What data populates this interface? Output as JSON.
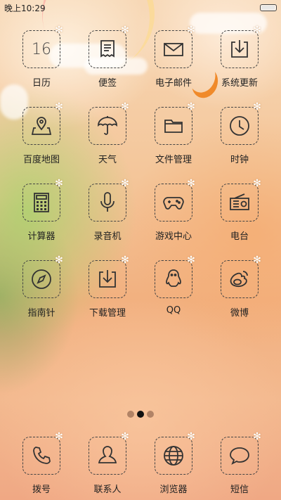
{
  "statusbar": {
    "time": "晚上10:29"
  },
  "apps": [
    {
      "label": "日历",
      "icon": "calendar-icon",
      "number": "16"
    },
    {
      "label": "便签",
      "icon": "note-icon"
    },
    {
      "label": "电子邮件",
      "icon": "mail-icon"
    },
    {
      "label": "系统更新",
      "icon": "system-update-icon"
    },
    {
      "label": "百度地图",
      "icon": "map-icon"
    },
    {
      "label": "天气",
      "icon": "umbrella-icon"
    },
    {
      "label": "文件管理",
      "icon": "folder-icon"
    },
    {
      "label": "时钟",
      "icon": "clock-icon"
    },
    {
      "label": "计算器",
      "icon": "calculator-icon"
    },
    {
      "label": "录音机",
      "icon": "microphone-icon"
    },
    {
      "label": "游戏中心",
      "icon": "gamepad-icon"
    },
    {
      "label": "电台",
      "icon": "radio-icon"
    },
    {
      "label": "指南针",
      "icon": "compass-icon"
    },
    {
      "label": "下载管理",
      "icon": "download-icon"
    },
    {
      "label": "QQ",
      "icon": "qq-penguin-icon"
    },
    {
      "label": "微博",
      "icon": "weibo-icon"
    }
  ],
  "dock": [
    {
      "label": "拨号",
      "icon": "phone-icon"
    },
    {
      "label": "联系人",
      "icon": "contact-icon"
    },
    {
      "label": "浏览器",
      "icon": "globe-icon"
    },
    {
      "label": "短信",
      "icon": "message-icon"
    }
  ],
  "page_indicator": {
    "pages": 3,
    "current": 2
  }
}
